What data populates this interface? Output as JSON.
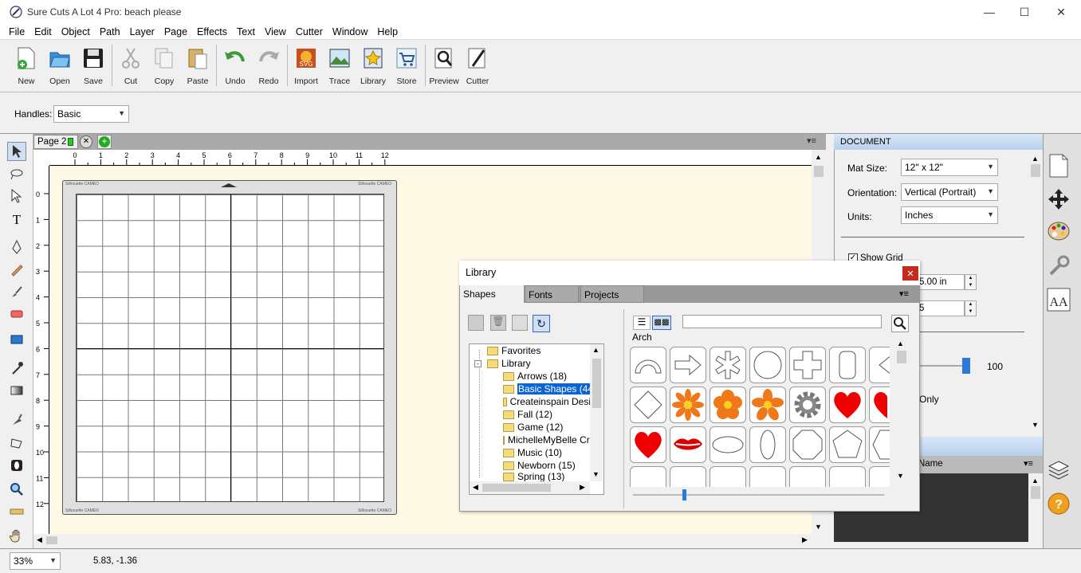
{
  "window": {
    "title": "Sure Cuts A Lot 4 Pro: beach please"
  },
  "menu": [
    "File",
    "Edit",
    "Object",
    "Path",
    "Layer",
    "Page",
    "Effects",
    "Text",
    "View",
    "Cutter",
    "Window",
    "Help"
  ],
  "toolbar": {
    "new": "New",
    "open": "Open",
    "save": "Save",
    "cut": "Cut",
    "copy": "Copy",
    "paste": "Paste",
    "undo": "Undo",
    "redo": "Redo",
    "import": "Import",
    "trace": "Trace",
    "library": "Library",
    "store": "Store",
    "preview": "Preview",
    "cutter": "Cutter"
  },
  "handles": {
    "label": "Handles:",
    "value": "Basic"
  },
  "page_tab": {
    "label": "Page 2"
  },
  "ruler": {
    "h": [
      "0",
      "1",
      "2",
      "3",
      "4",
      "5",
      "6",
      "7",
      "8",
      "9",
      "10",
      "11",
      "12"
    ],
    "v": [
      "0",
      "1",
      "2",
      "3",
      "4",
      "5",
      "6",
      "7",
      "8",
      "9",
      "10",
      "11",
      "12"
    ]
  },
  "mat": {
    "brand": "Silhouette CAMEO"
  },
  "document": {
    "header": "DOCUMENT",
    "mat_size_label": "Mat Size:",
    "mat_size": "12\" x 12\"",
    "orientation_label": "Orientation:",
    "orientation": "Vertical (Portrait)",
    "units_label": "Units:",
    "units": "Inches",
    "show_grid": "Show Grid",
    "grid_value": "5.00 in",
    "grid_value2": "5",
    "slider_value": "100",
    "only_label": "Only"
  },
  "layers": {
    "name_col": "Name"
  },
  "status": {
    "zoom": "33%",
    "coords": "5.83, -1.36"
  },
  "library": {
    "title": "Library",
    "tabs": [
      "Shapes",
      "Fonts",
      "Projects"
    ],
    "tree": [
      {
        "label": "Favorites"
      },
      {
        "label": "Library"
      },
      {
        "label": "Arrows (18)"
      },
      {
        "label": "Basic Shapes (44)"
      },
      {
        "label": "Createinspain Desi"
      },
      {
        "label": "Fall (12)"
      },
      {
        "label": "Game (12)"
      },
      {
        "label": "MichelleMyBelle Cre"
      },
      {
        "label": "Music (10)"
      },
      {
        "label": "Newborn (15)"
      },
      {
        "label": "Spring (13)"
      }
    ],
    "current_shape": "Arch",
    "search_placeholder": ""
  }
}
